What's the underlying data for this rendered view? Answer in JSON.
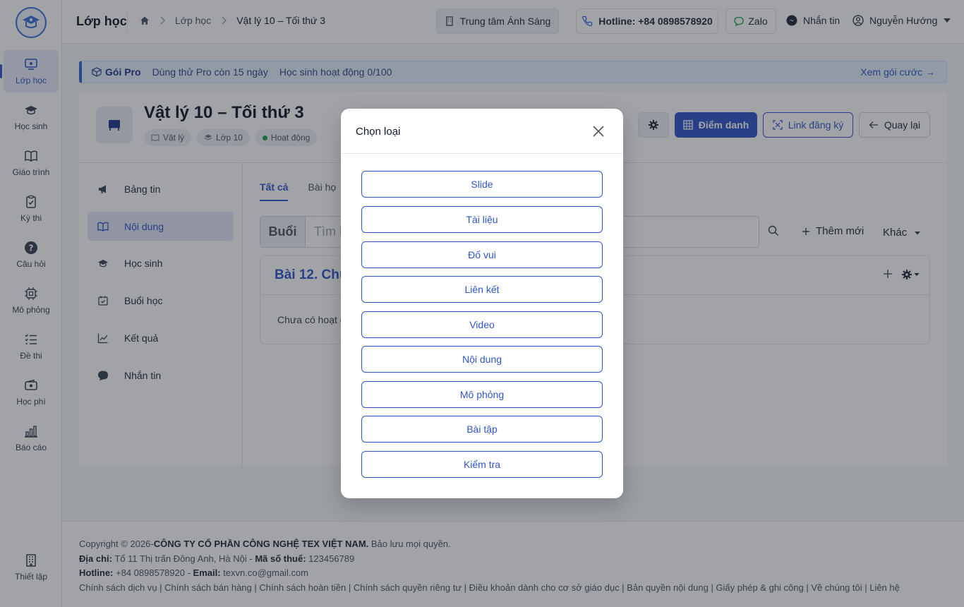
{
  "header": {
    "title": "Lớp học",
    "breadcrumb": [
      "Lớp học",
      "Vật lý 10 – Tối thứ 3"
    ],
    "center": "Trung tâm Ánh Sáng",
    "hotline": "Hotline: +84 0898578920",
    "zalo": "Zalo",
    "message": "Nhắn tin",
    "user": "Nguyễn Hướng"
  },
  "sidebar": {
    "items": [
      {
        "label": "Lớp học",
        "icon": "classroom-icon"
      },
      {
        "label": "Học sinh",
        "icon": "graduation-cap-icon"
      },
      {
        "label": "Giáo trình",
        "icon": "book-icon"
      },
      {
        "label": "Kỳ thi",
        "icon": "clipboard-check-icon"
      },
      {
        "label": "Câu hỏi",
        "icon": "question-circle-icon"
      },
      {
        "label": "Mô phỏng",
        "icon": "chip-icon"
      },
      {
        "label": "Đề thi",
        "icon": "list-icon"
      },
      {
        "label": "Học phí",
        "icon": "wallet-icon"
      },
      {
        "label": "Báo cáo",
        "icon": "bar-chart-icon"
      }
    ],
    "settings": "Thiết lập"
  },
  "banner": {
    "pro": "Gói Pro",
    "trial": "Dùng thử Pro còn 15 ngày",
    "students": "Học sinh hoạt động 0/100",
    "link": "Xem gói cước →"
  },
  "class_info": {
    "title": "Vật lý 10 – Tối thứ 3",
    "chips": [
      "Vật lý",
      "Lớp 10",
      "Hoạt động"
    ],
    "attendance": "Điểm danh",
    "register_link": "Link đăng ký",
    "back": "Quay lại"
  },
  "submenu": [
    "Bảng tin",
    "Nội dung",
    "Học sinh",
    "Buổi học",
    "Kết quả",
    "Nhắn tin"
  ],
  "content": {
    "tabs": [
      "Tất cả",
      "Bài họ"
    ],
    "search_prefix": "Buổi",
    "search_placeholder": "Tìm k",
    "add_new": "Thêm mới",
    "more": "Khác",
    "lesson_title": "Bài 12. Chu",
    "empty": "Chưa có hoạt đ"
  },
  "modal": {
    "title": "Chọn loại",
    "options": [
      "Slide",
      "Tài liệu",
      "Đố vui",
      "Liên kết",
      "Video",
      "Nội dung",
      "Mô phỏng",
      "Bài tập",
      "Kiểm tra"
    ]
  },
  "footer": {
    "copyright_prefix": "Copyright © 2026-",
    "company": "CÔNG TY CỔ PHẦN CÔNG NGHỆ TEX VIỆT NAM.",
    "rights": " Bảo lưu mọi quyền.",
    "address_label": "Địa chỉ:",
    "address": " Tổ 11 Thị trấn Đông Anh, Hà Nội - ",
    "tax_label": "Mã số thuế:",
    "tax": " 123456789",
    "hotline_label": "Hotline:",
    "hotline": " +84 0898578920 - ",
    "email_label": "Email:",
    "email": " texvn.co@gmail.com",
    "links": "Chính sách dịch vụ | Chính sách bán hàng | Chính sách hoàn tiền | Chính sách quyền riêng tư | Điều khoản dành cho cơ sở giáo dục | Bản quyền nội dung | Giấy phép & ghi công | Về chúng tôi | Liên hệ"
  },
  "colors": {
    "accent": "#2f55c9",
    "banner_bg": "#e6f0fb",
    "active_status": "#16a34a"
  }
}
